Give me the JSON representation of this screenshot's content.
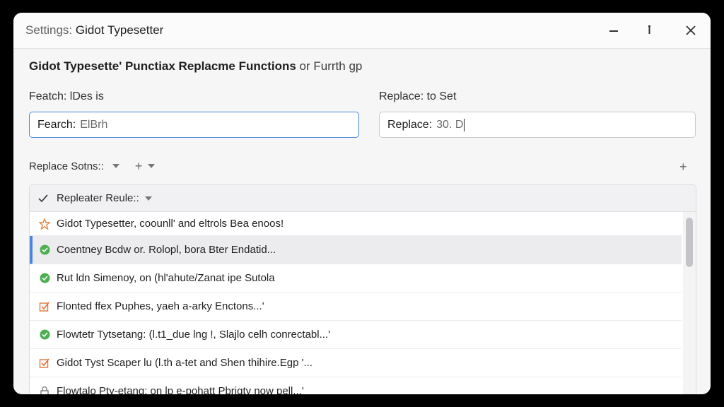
{
  "window": {
    "title_prefix": "Settings:",
    "title_app": "Gidot Typesetter"
  },
  "heading": {
    "bold": "Gidot Typesette' Punctiax Replacme Functions",
    "rest": "or Furrth gp"
  },
  "search": {
    "label": "Featch: lDes is",
    "prefix": "Fearch:",
    "value": "ElBrh"
  },
  "replace": {
    "label": "Replace: to Set",
    "prefix": "Replace:",
    "value": "30. D"
  },
  "options": {
    "label": "Replace Sotns::"
  },
  "list": {
    "header": "Repleater Reule::",
    "items": [
      {
        "text": "Gidot Typesetter, coounll' and eltrols Bea enoos!",
        "icon": "star-icon"
      },
      {
        "text": "Coentney Bcdw or. Rolopl, bora Bter Endatid...",
        "icon": "check-circle-icon"
      },
      {
        "text": "Rut ldn Simenoy, on (hl'ahute/Zanat ipe Sutola",
        "icon": "check-circle-icon"
      },
      {
        "text": "Flonted ffex Puphes, yaeh a-arky Enctons...'",
        "icon": "checkbox-icon"
      },
      {
        "text": "Flowtetr Tytsetang: (l.t1_due lng !, Slajlo celh conrectabl...'",
        "icon": "check-circle-icon"
      },
      {
        "text": "Gidot Tyst Scaper lu (l.th a-tet and Shen thihire.Egp '...",
        "icon": "checkbox-icon"
      },
      {
        "text": "Flowtalo Pty-etang: on lp e-pohatt Pbrigty now pell...'",
        "icon": "lock-icon"
      }
    ]
  },
  "colors": {
    "accent": "#4a86d8",
    "check": "#4caf50",
    "star": "#e8833a"
  }
}
